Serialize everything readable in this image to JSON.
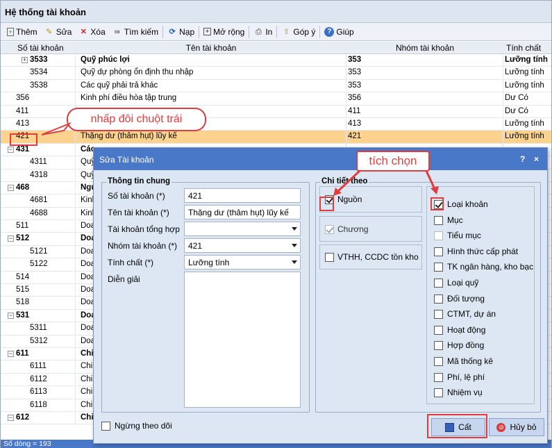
{
  "window": {
    "title": "Hệ thống tài khoản"
  },
  "toolbar": {
    "add": "Thêm",
    "edit": "Sửa",
    "delete": "Xóa",
    "search": "Tìm kiếm",
    "reload": "Nạp",
    "expand": "Mở rộng",
    "print": "In",
    "feedback": "Góp ý",
    "help": "Giúp"
  },
  "grid": {
    "headers": [
      "Số tài khoản",
      "Tên tài khoản",
      "Nhóm tài khoản",
      "Tính chất"
    ],
    "rows": [
      {
        "code": "3533",
        "name": "Quỹ phúc lợi",
        "group": "353",
        "nature": "Lưỡng tính"
      },
      {
        "code": "3534",
        "name": "Quỹ dự phòng ổn định thu nhập",
        "group": "353",
        "nature": "Lưỡng tính"
      },
      {
        "code": "3538",
        "name": "Các quỹ phải trả khác",
        "group": "353",
        "nature": "Lưỡng tính"
      },
      {
        "code": "356",
        "name": "Kinh phí điều hòa tập trung",
        "group": "356",
        "nature": "Dư Có"
      },
      {
        "code": "411",
        "name": "",
        "group": "411",
        "nature": "Dư Có"
      },
      {
        "code": "413",
        "name": "",
        "group": "413",
        "nature": "Lưỡng tính"
      },
      {
        "code": "421",
        "name": "Thặng dư (thâm hụt) lũy kế",
        "group": "421",
        "nature": "Lưỡng tính"
      },
      {
        "code": "431",
        "name": "Các",
        "group": "",
        "nature": ""
      },
      {
        "code": "4311",
        "name": "Quỹ",
        "group": "",
        "nature": ""
      },
      {
        "code": "4318",
        "name": "Quỹ",
        "group": "",
        "nature": ""
      },
      {
        "code": "468",
        "name": "Ngu",
        "group": "",
        "nature": ""
      },
      {
        "code": "4681",
        "name": "Kinh",
        "group": "",
        "nature": ""
      },
      {
        "code": "4688",
        "name": "Kinh",
        "group": "",
        "nature": ""
      },
      {
        "code": "511",
        "name": "Doa",
        "group": "",
        "nature": ""
      },
      {
        "code": "512",
        "name": "Doa",
        "group": "",
        "nature": ""
      },
      {
        "code": "5121",
        "name": "Doa",
        "group": "",
        "nature": ""
      },
      {
        "code": "5122",
        "name": "Doa",
        "group": "",
        "nature": ""
      },
      {
        "code": "514",
        "name": "Doa",
        "group": "",
        "nature": ""
      },
      {
        "code": "515",
        "name": "Doa",
        "group": "",
        "nature": ""
      },
      {
        "code": "518",
        "name": "Doa",
        "group": "",
        "nature": ""
      },
      {
        "code": "531",
        "name": "Doa",
        "group": "",
        "nature": ""
      },
      {
        "code": "5311",
        "name": "Doa",
        "group": "",
        "nature": ""
      },
      {
        "code": "5312",
        "name": "Doa",
        "group": "",
        "nature": ""
      },
      {
        "code": "611",
        "name": "Chi",
        "group": "",
        "nature": ""
      },
      {
        "code": "6111",
        "name": "Chi",
        "group": "",
        "nature": ""
      },
      {
        "code": "6112",
        "name": "Chi",
        "group": "",
        "nature": ""
      },
      {
        "code": "6113",
        "name": "Chi",
        "group": "",
        "nature": ""
      },
      {
        "code": "6118",
        "name": "Chi",
        "group": "",
        "nature": ""
      },
      {
        "code": "612",
        "name": "Chi",
        "group": "",
        "nature": ""
      }
    ],
    "footer": "Số dòng = 193"
  },
  "annotations": {
    "double_click": "nhấp đôi chuột trái",
    "tick": "tích chọn"
  },
  "dialog": {
    "title": "Sửa Tài khoản",
    "help": "?",
    "close": "×",
    "general": {
      "legend": "Thông tin chung",
      "code_label": "Số tài khoản (*)",
      "code_value": "421",
      "name_label": "Tên tài khoản (*)",
      "name_value": "Thặng dư (thâm hụt) lũy kế",
      "parent_label": "Tài khoản tổng hợp",
      "parent_value": "",
      "group_label": "Nhóm tài khoản (*)",
      "group_value": "421",
      "nature_label": "Tính chất (*)",
      "nature_value": "Lưỡng tính",
      "desc_label": "Diễn giải",
      "desc_value": ""
    },
    "detail": {
      "legend": "Chi tiết theo",
      "left": [
        {
          "label": "Nguồn",
          "checked": true
        },
        {
          "label": "Chương",
          "checked": true
        },
        {
          "label": "VTHH, CCDC tồn kho",
          "checked": false
        }
      ],
      "right": [
        {
          "label": "Loại khoản",
          "checked": true
        },
        {
          "label": "Mục",
          "checked": false
        },
        {
          "label": "Tiểu mục",
          "checked": false
        },
        {
          "label": "Hình thức cấp phát",
          "checked": false
        },
        {
          "label": "TK ngân hàng, kho bạc",
          "checked": false
        },
        {
          "label": "Loại quỹ",
          "checked": false
        },
        {
          "label": "Đối tượng",
          "checked": false
        },
        {
          "label": "CTMT, dự án",
          "checked": false
        },
        {
          "label": "Hoạt động",
          "checked": false
        },
        {
          "label": "Hợp đồng",
          "checked": false
        },
        {
          "label": "Mã thống kê",
          "checked": false
        },
        {
          "label": "Phí, lệ phí",
          "checked": false
        },
        {
          "label": "Nhiệm vụ",
          "checked": false
        }
      ]
    },
    "stop_tracking": "Ngừng theo dõi",
    "save": "Cất",
    "cancel": "Hủy bỏ"
  },
  "colors": {
    "accent": "#4a78c8",
    "selected_row": "#fbd38f",
    "annotation": "#e03c3c"
  }
}
